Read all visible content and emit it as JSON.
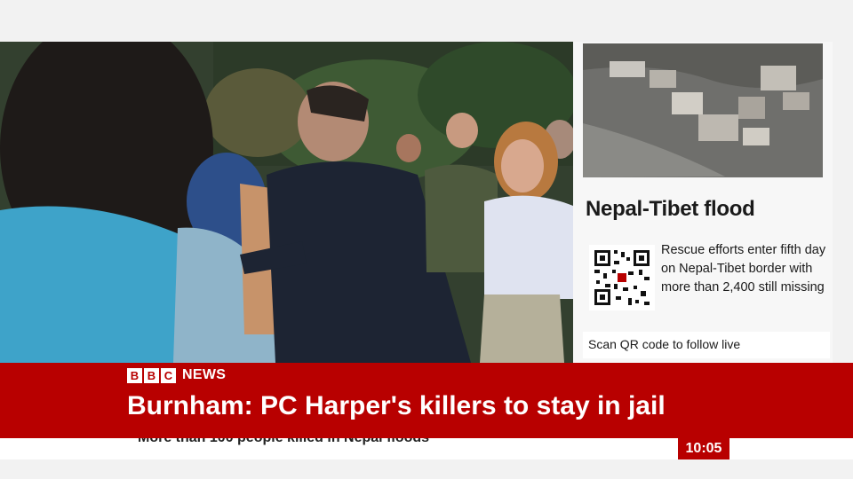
{
  "brand": {
    "bbc_letters": [
      "B",
      "B",
      "C"
    ],
    "news_word": "NEWS",
    "brand_red": "#b80000"
  },
  "headline": "Burnham: PC Harper's killers to stay in jail",
  "ticker": "More than 100 people killed in Nepal floods",
  "clock": "10:05",
  "side_panel": {
    "title": "Nepal-Tibet flood",
    "story": "Rescue efforts enter fifth day on Nepal-Tibet border with more than 2,400 still missing",
    "scan_prompt": "Scan QR code to follow live",
    "qr_icon": "qr-code-icon"
  },
  "video": {
    "scene": "news-footage"
  }
}
